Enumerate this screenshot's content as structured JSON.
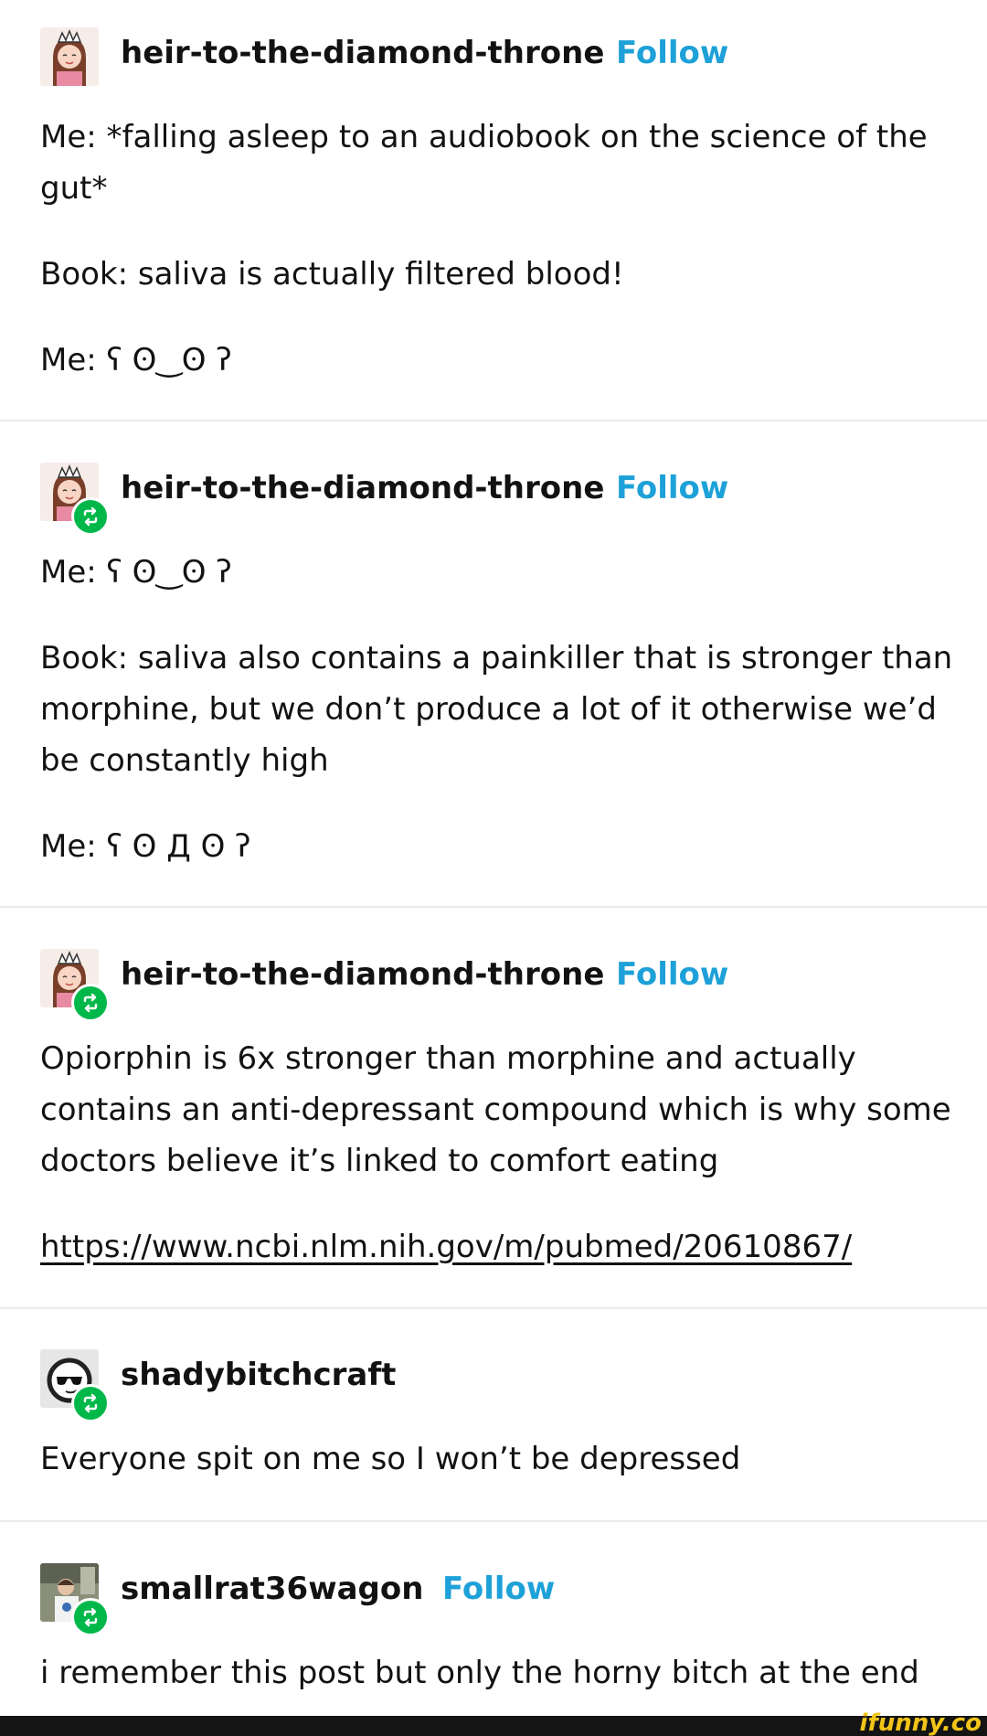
{
  "posts": [
    {
      "username": "heir-to-the-diamond-throne",
      "follow_label": "Follow",
      "is_reblog": false,
      "avatar_icon": "anime-girl-avatar",
      "paragraphs": [
        "Me: *falling asleep to an audiobook on the science of the",
        "gut*",
        "Book: saliva is actually filtered blood!",
        "Me: ʕ ʘ‿ʘ ʔ"
      ]
    },
    {
      "username": "heir-to-the-diamond-throne",
      "follow_label": "Follow",
      "is_reblog": true,
      "avatar_icon": "anime-girl-avatar",
      "paragraphs": [
        "Me: ʕ ʘ‿ʘ ʔ",
        "Book: saliva also contains a painkiller that is stronger than",
        "morphine, but we don’t produce a lot of it otherwise we’d",
        "be constantly high",
        "Me: ʕ ʘ Д ʘ ʔ"
      ]
    },
    {
      "username": "heir-to-the-diamond-throne",
      "follow_label": "Follow",
      "is_reblog": true,
      "avatar_icon": "anime-girl-avatar",
      "paragraphs": [
        "Opiorphin is 6x stronger than morphine and actually",
        "contains an anti-depressant compound which is why some",
        "doctors believe it’s linked to comfort eating"
      ],
      "link": "https://www.ncbi.nlm.nih.gov/m/pubmed/20610867/"
    },
    {
      "username": "shadybitchcraft",
      "is_reblog": true,
      "avatar_icon": "sunglasses-face-avatar",
      "paragraphs": [
        "Everyone spit on me so I won’t be depressed"
      ]
    },
    {
      "username": "smallrat36wagon",
      "follow_label": "Follow",
      "is_reblog": true,
      "avatar_icon": "photo-avatar",
      "paragraphs": [
        "i remember this post but only the horny bitch at the end"
      ]
    }
  ],
  "watermark": "ifunny.co",
  "colors": {
    "follow": "#1da1d8",
    "reblog_badge": "#00b84a",
    "text": "#121212",
    "divider": "#ebebeb",
    "watermark": "#f2c418"
  }
}
